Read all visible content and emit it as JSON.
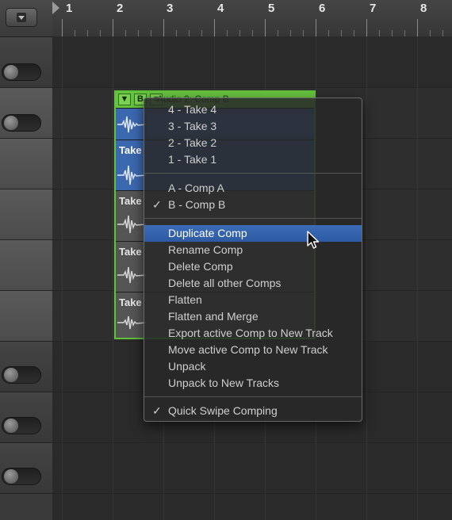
{
  "ruler": {
    "bars": [
      "1",
      "2",
      "3",
      "4",
      "5",
      "6",
      "7",
      "8"
    ]
  },
  "take_folder": {
    "header_buttons": [
      "▼",
      "B",
      "≡"
    ],
    "title": "Audio 2: Comp B",
    "takes": [
      {
        "label": "",
        "state": "active"
      },
      {
        "label": "Take",
        "state": "active"
      },
      {
        "label": "Take",
        "state": "inactive"
      },
      {
        "label": "Take",
        "state": "inactive"
      },
      {
        "label": "Take",
        "state": "inactive"
      }
    ]
  },
  "context_menu": {
    "takes": [
      "4 - Take 4",
      "3 - Take 3",
      "2 - Take 2",
      "1 - Take 1"
    ],
    "comps": [
      {
        "label": "A - Comp A",
        "checked": false
      },
      {
        "label": "B - Comp B",
        "checked": true
      }
    ],
    "commands": [
      "Duplicate Comp",
      "Rename Comp",
      "Delete Comp",
      "Delete all other Comps",
      "Flatten",
      "Flatten and Merge",
      "Export active Comp to New Track",
      "Move active Comp to New Track",
      "Unpack",
      "Unpack to New Tracks"
    ],
    "highlighted": "Duplicate Comp",
    "quick_swipe": {
      "label": "Quick Swipe Comping",
      "checked": true
    },
    "check_glyph": "✓"
  },
  "colors": {
    "take_folder_green": "#67c23f",
    "highlight_blue": "#2c5aa3",
    "active_take_blue": "#3c68b0"
  }
}
